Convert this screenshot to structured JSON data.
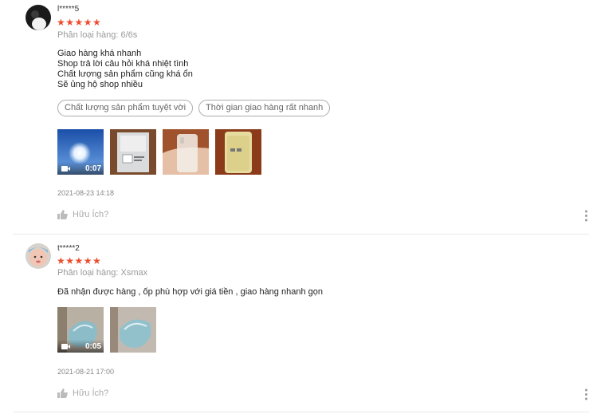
{
  "reviews": [
    {
      "username": "l*****5",
      "stars": "★★★★★",
      "variant": "Phân loại hàng: 6/6s",
      "comment_lines": [
        "Giao hàng khá nhanh",
        "Shop trả lời câu hỏi khá nhiệt tình",
        "Chất lượng sản phẩm cũng khá ổn",
        "Sẽ ủng hộ shop nhiều"
      ],
      "tags": [
        "Chất lượng sản phẩm tuyệt vời",
        "Thời gian giao hàng rất nhanh"
      ],
      "video_duration": "0:07",
      "date": "2021-08-23 14:18",
      "helpful": "Hữu Ích?"
    },
    {
      "username": "t*****2",
      "stars": "★★★★★",
      "variant": "Phân loại hàng: Xsmax",
      "comment_lines": [
        "Đã nhận được hàng , ốp phù hợp với giá tiền , giao hàng nhanh gọn"
      ],
      "video_duration": "0:05",
      "date": "2021-08-21 17:00",
      "helpful": "Hữu Ích?"
    }
  ],
  "icons": [
    "avatar",
    "video-camera-icon",
    "thumbs-up-icon",
    "more-options-icon"
  ],
  "colors": {
    "star": "#ee4d2d",
    "muted": "#999999",
    "tag_border": "#aaaaaa"
  }
}
